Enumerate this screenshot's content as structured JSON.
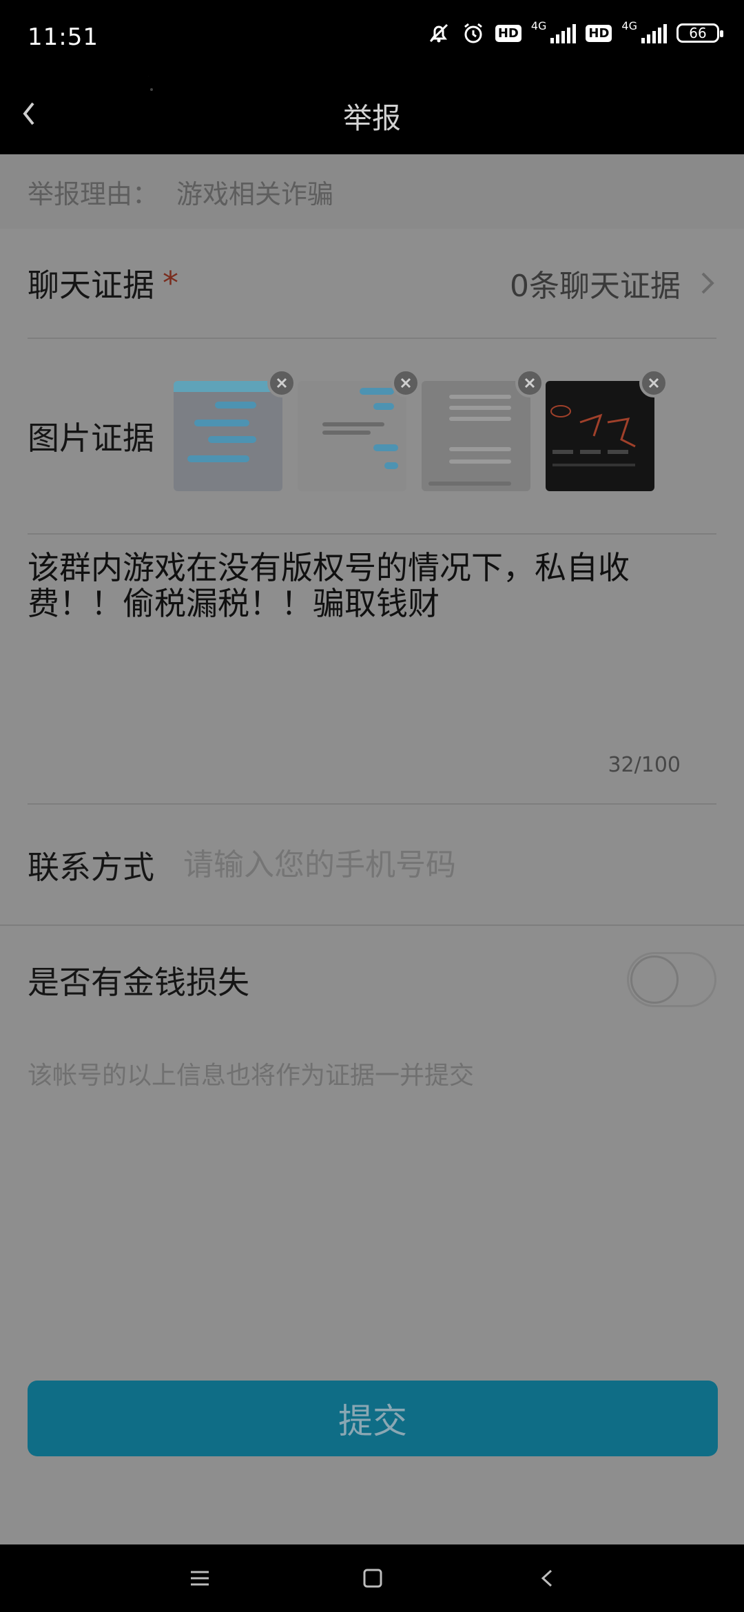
{
  "status_bar": {
    "time": "11:51",
    "hd_label": "HD",
    "network_label": "4G",
    "battery": "66",
    "icons": [
      "mute-bell-icon",
      "alarm-icon",
      "signal-icon",
      "battery-icon"
    ]
  },
  "header": {
    "title": "举报",
    "back_icon": "chevron-left-icon"
  },
  "form": {
    "reason_label": "举报理由：",
    "reason_value": "游戏相关诈骗",
    "chat_evidence_label": "聊天证据",
    "required_mark": "*",
    "chat_evidence_value": "0条聊天证据",
    "image_evidence_label": "图片证据",
    "image_count": 4,
    "description_text": "该群内游戏在没有版权号的情况下，私自收费！！偷税漏税！！骗取钱财",
    "char_counter": "32/100",
    "contact_label": "联系方式",
    "contact_placeholder": "请输入您的手机号码",
    "money_loss_label": "是否有金钱损失",
    "money_loss_on": false,
    "hint_text": "该帐号的以上信息也将作为证据一并提交",
    "submit_label": "提交"
  },
  "colors": {
    "submit_bg": "#0f6d86",
    "required_star": "#7a2d1e",
    "overlay_bg": "#8e8e8e"
  },
  "nav_bar": {
    "icons": [
      "menu-icon",
      "home-square-icon",
      "back-triangle-icon"
    ]
  }
}
